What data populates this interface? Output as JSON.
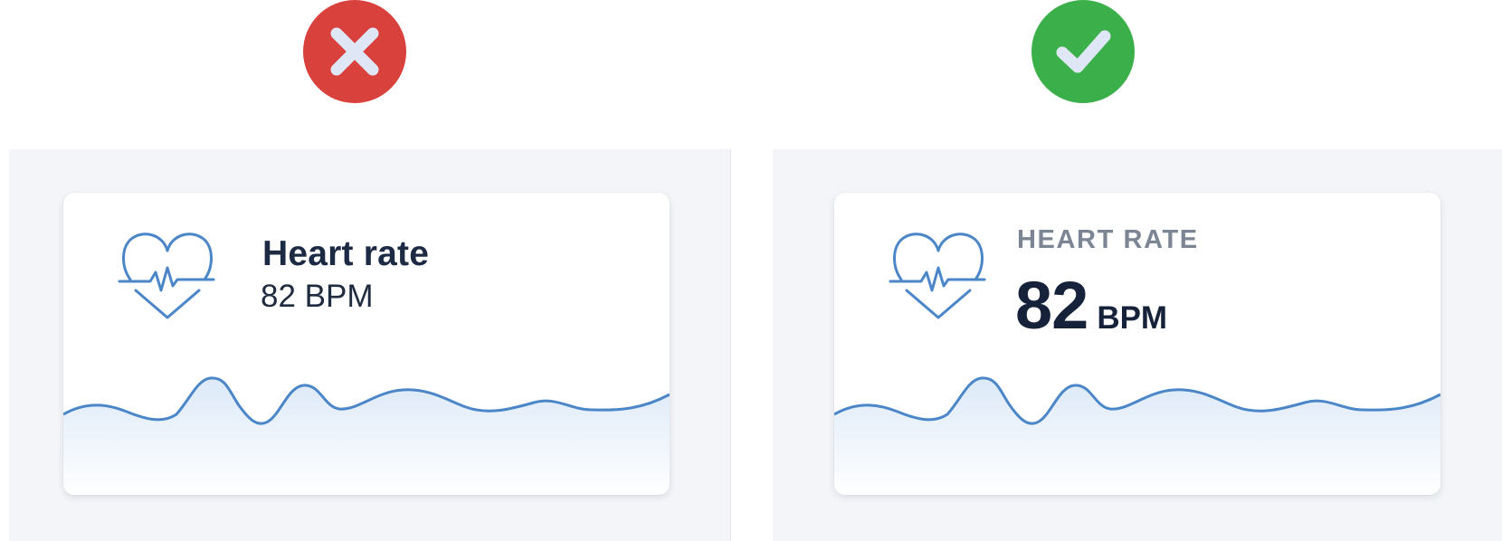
{
  "colors": {
    "bad": "#d9413d",
    "good": "#3bb04a",
    "mark": "#dfe6f5",
    "accent": "#4a86c8",
    "panel_bg": "#f3f5f8",
    "text_dark": "#15223a",
    "text_muted": "#7c8593"
  },
  "icons": {
    "bad": "close-icon",
    "good": "check-icon",
    "card": "heart-pulse-icon"
  },
  "bad_example": {
    "title": "Heart rate",
    "value_text": "82 BPM"
  },
  "good_example": {
    "label": "HEART RATE",
    "value": "82",
    "unit": "BPM"
  }
}
